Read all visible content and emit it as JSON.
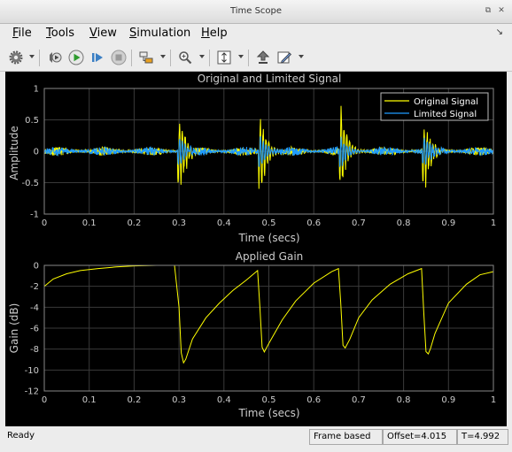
{
  "window": {
    "title": "Time Scope",
    "restore_glyph": "⧉",
    "close_glyph": "✕"
  },
  "menu": [
    {
      "label": "File",
      "ul": "F",
      "rest": "ile"
    },
    {
      "label": "Tools",
      "ul": "T",
      "rest": "ools"
    },
    {
      "label": "View",
      "ul": "V",
      "rest": "iew"
    },
    {
      "label": "Simulation",
      "ul": "S",
      "rest": "imulation"
    },
    {
      "label": "Help",
      "ul": "H",
      "rest": "elp"
    }
  ],
  "menu_dock_glyph": "↘",
  "toolbar": {
    "icons": [
      "gear-icon",
      "highlight-icon",
      "run-icon",
      "step-forward-icon",
      "stop-icon",
      "signal-select-icon",
      "zoom-icon",
      "scale-axes-icon",
      "restore-view-icon",
      "style-icon"
    ]
  },
  "plot1": {
    "title": "Original and Limited Signal",
    "xlabel": "Time (secs)",
    "ylabel": "Amplitude",
    "yticks": [
      "1",
      "0.5",
      "0",
      "-0.5",
      "-1"
    ],
    "xticks": [
      "0",
      "0.1",
      "0.2",
      "0.3",
      "0.4",
      "0.5",
      "0.6",
      "0.7",
      "0.8",
      "0.9",
      "1"
    ],
    "legend": [
      "Original Signal",
      "Limited Signal"
    ]
  },
  "plot2": {
    "title": "Applied Gain",
    "xlabel": "Time (secs)",
    "ylabel": "Gain (dB)",
    "yticks": [
      "0",
      "-2",
      "-4",
      "-6",
      "-8",
      "-10",
      "-12"
    ],
    "xticks": [
      "0",
      "0.1",
      "0.2",
      "0.3",
      "0.4",
      "0.5",
      "0.6",
      "0.7",
      "0.8",
      "0.9",
      "1"
    ]
  },
  "chart_data": [
    {
      "type": "line",
      "title": "Original and Limited Signal",
      "xlabel": "Time (secs)",
      "ylabel": "Amplitude",
      "xlim": [
        0,
        1
      ],
      "ylim": [
        -1,
        1
      ],
      "grid": true,
      "legend_position": "top-right",
      "series": [
        {
          "name": "Original Signal",
          "color": "#ffff00",
          "events": [
            {
              "t": 0.3,
              "peak": 0.63,
              "trough": -0.78
            },
            {
              "t": 0.48,
              "peak": 0.62,
              "trough": -0.7
            },
            {
              "t": 0.66,
              "peak": 0.82,
              "trough": -0.55
            },
            {
              "t": 0.845,
              "peak": 0.48,
              "trough": -0.65
            }
          ],
          "baseline_noise": 0.07
        },
        {
          "name": "Limited Signal",
          "color": "#1f9bff",
          "events": [
            {
              "t": 0.3,
              "peak": 0.3,
              "trough": -0.3
            },
            {
              "t": 0.48,
              "peak": 0.28,
              "trough": -0.3
            },
            {
              "t": 0.66,
              "peak": 0.25,
              "trough": -0.25
            },
            {
              "t": 0.845,
              "peak": 0.25,
              "trough": -0.28
            }
          ],
          "baseline_noise": 0.07
        }
      ]
    },
    {
      "type": "line",
      "title": "Applied Gain",
      "xlabel": "Time (secs)",
      "ylabel": "Gain (dB)",
      "xlim": [
        0,
        1
      ],
      "ylim": [
        -12,
        0
      ],
      "grid": true,
      "series": [
        {
          "color": "#ffff00",
          "x": [
            0,
            0.02,
            0.05,
            0.08,
            0.12,
            0.16,
            0.2,
            0.25,
            0.29,
            0.3,
            0.305,
            0.31,
            0.315,
            0.33,
            0.36,
            0.39,
            0.42,
            0.45,
            0.475,
            0.48,
            0.485,
            0.49,
            0.5,
            0.53,
            0.56,
            0.6,
            0.64,
            0.655,
            0.66,
            0.665,
            0.67,
            0.68,
            0.7,
            0.73,
            0.77,
            0.81,
            0.84,
            0.845,
            0.85,
            0.855,
            0.86,
            0.87,
            0.9,
            0.94,
            0.97,
            1.0
          ],
          "y": [
            -2.0,
            -1.3,
            -0.8,
            -0.5,
            -0.3,
            -0.15,
            -0.05,
            0,
            0,
            -4.0,
            -8.2,
            -9.4,
            -9.0,
            -7.1,
            -5.0,
            -3.6,
            -2.4,
            -1.4,
            -0.5,
            -4.0,
            -7.8,
            -8.4,
            -7.5,
            -5.2,
            -3.4,
            -1.7,
            -0.6,
            -0.3,
            -3.5,
            -7.5,
            -7.8,
            -7.0,
            -5.0,
            -3.3,
            -1.8,
            -0.8,
            -0.3,
            -4.5,
            -8.3,
            -8.6,
            -8.0,
            -6.5,
            -3.6,
            -1.8,
            -0.9,
            -0.6
          ]
        }
      ]
    }
  ],
  "status": {
    "ready": "Ready",
    "mode": "Frame based",
    "offset": "Offset=4.015",
    "time": "T=4.992"
  }
}
